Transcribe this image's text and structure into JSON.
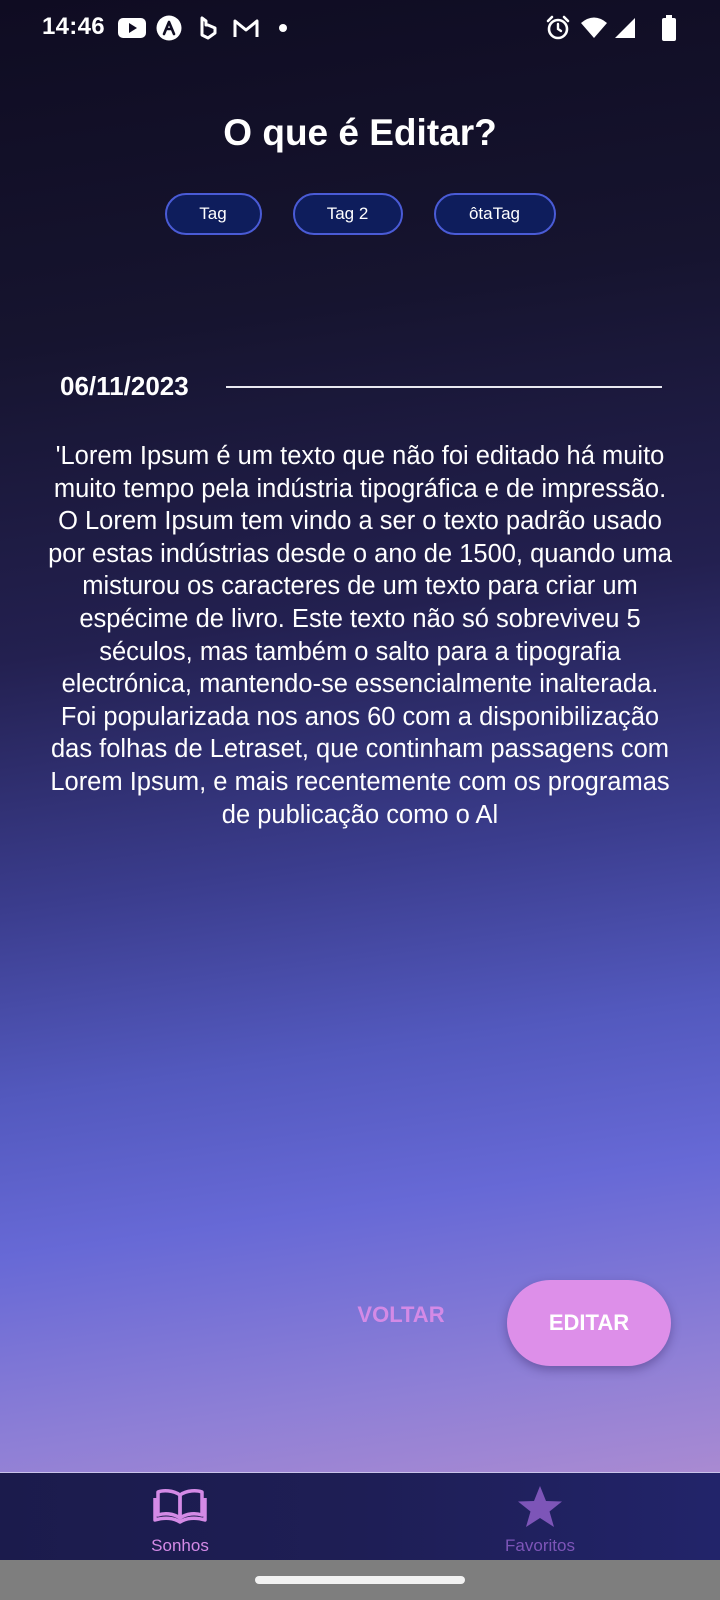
{
  "status_bar": {
    "time": "14:46",
    "left_icons": [
      "youtube-icon",
      "notification-a-icon",
      "bing-icon",
      "gmail-icon",
      "dot-icon"
    ],
    "right_icons": [
      "alarm-icon",
      "wifi-icon",
      "signal-icon",
      "battery-icon"
    ]
  },
  "page": {
    "title": "O que é Editar?",
    "tags": [
      "Tag",
      "Tag 2",
      "ôtaTag"
    ],
    "date": "06/11/2023",
    "body": "'Lorem Ipsum é um texto que não foi editado há muito muito tempo pela indústria tipográfica e de impressão. O Lorem Ipsum tem vindo a ser o texto padrão usado por estas indústrias desde o ano de 1500, quando uma misturou os caracteres de um texto para criar um espécime de livro. Este texto não só sobreviveu 5 séculos, mas também o salto para a tipografia electrónica, mantendo-se essencialmente inalterada. Foi popularizada nos anos 60 com a disponibilização das folhas de Letraset, que continham passagens com Lorem Ipsum, e mais recentemente com os programas de publicação como o Al"
  },
  "actions": {
    "back_label": "VOLTAR",
    "edit_label": "EDITAR"
  },
  "bottom_nav": {
    "items": [
      {
        "label": "Sonhos",
        "icon": "book-icon",
        "active": true,
        "color": "#d48ae6"
      },
      {
        "label": "Favoritos",
        "icon": "star-icon",
        "active": false,
        "color": "#7d55b8"
      }
    ]
  },
  "colors": {
    "accent": "#dd8fe9",
    "tag_bg": "#0e1d5c",
    "tag_border": "#4a5bd6"
  }
}
